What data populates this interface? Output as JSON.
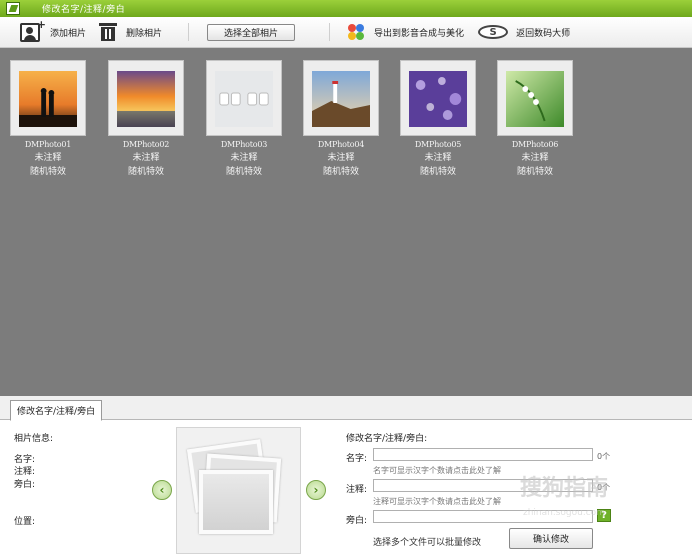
{
  "window": {
    "title": "修改名字/注释/旁白"
  },
  "toolbar": {
    "add_label": "添加相片",
    "delete_label": "删除相片",
    "select_all_label": "选择全部相片",
    "export_label": "导出到影音合成与美化",
    "back_label": "返回数码大师",
    "back_icon_glyph": "S"
  },
  "photos": [
    {
      "name": "DMPhoto01",
      "note": "未注释",
      "effect": "随机特效"
    },
    {
      "name": "DMPhoto02",
      "note": "未注释",
      "effect": "随机特效"
    },
    {
      "name": "DMPhoto03",
      "note": "未注释",
      "effect": "随机特效"
    },
    {
      "name": "DMPhoto04",
      "note": "未注释",
      "effect": "随机特效"
    },
    {
      "name": "DMPhoto05",
      "note": "未注释",
      "effect": "随机特效"
    },
    {
      "name": "DMPhoto06",
      "note": "未注释",
      "effect": "随机特效"
    }
  ],
  "panel": {
    "tab_label": "修改名字/注释/旁白",
    "info_title": "相片信息:",
    "info_name": "名字:",
    "info_note": "注释:",
    "info_narration": "旁白:",
    "info_position": "位置:",
    "edit_title": "修改名字/注释/旁白:",
    "name_label": "名字:",
    "name_value": "",
    "name_count": "0个",
    "name_hint": "名字可显示汉字个数请点击此处了解",
    "note_label": "注释:",
    "note_value": "",
    "note_count": "0个",
    "note_hint": "注释可显示汉字个数请点击此处了解",
    "narration_label": "旁白:",
    "narration_value": "",
    "help_glyph": "?",
    "batch_hint": "选择多个文件可以批量修改",
    "confirm_label": "确认修改",
    "prev_glyph": "‹",
    "next_glyph": "›"
  },
  "watermark": {
    "text": "搜狗指南",
    "sub": "zhinan.sogou.com"
  }
}
